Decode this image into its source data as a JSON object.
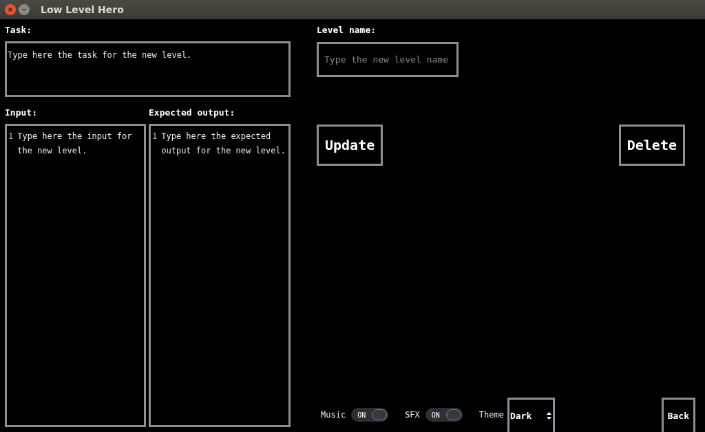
{
  "window": {
    "title": "Low Level Hero"
  },
  "task": {
    "label": "Task:",
    "placeholder": "Type here the task for the new level."
  },
  "editors": [
    {
      "label": "Input:",
      "line_number": "1",
      "placeholder": "Type here the input for the new level."
    },
    {
      "label": "Expected output:",
      "line_number": "1",
      "placeholder": "Type here the expected output for the new level."
    }
  ],
  "level_name": {
    "label": "Level name:",
    "placeholder": "Type the new level name"
  },
  "actions": [
    "Update",
    "Delete"
  ],
  "settings": {
    "toggles": [
      {
        "label": "Music",
        "state_text": "ON",
        "on": true
      },
      {
        "label": "SFX",
        "state_text": "ON",
        "on": true
      }
    ],
    "theme": {
      "label": "Theme",
      "value": "Dark"
    }
  },
  "back": "Back"
}
